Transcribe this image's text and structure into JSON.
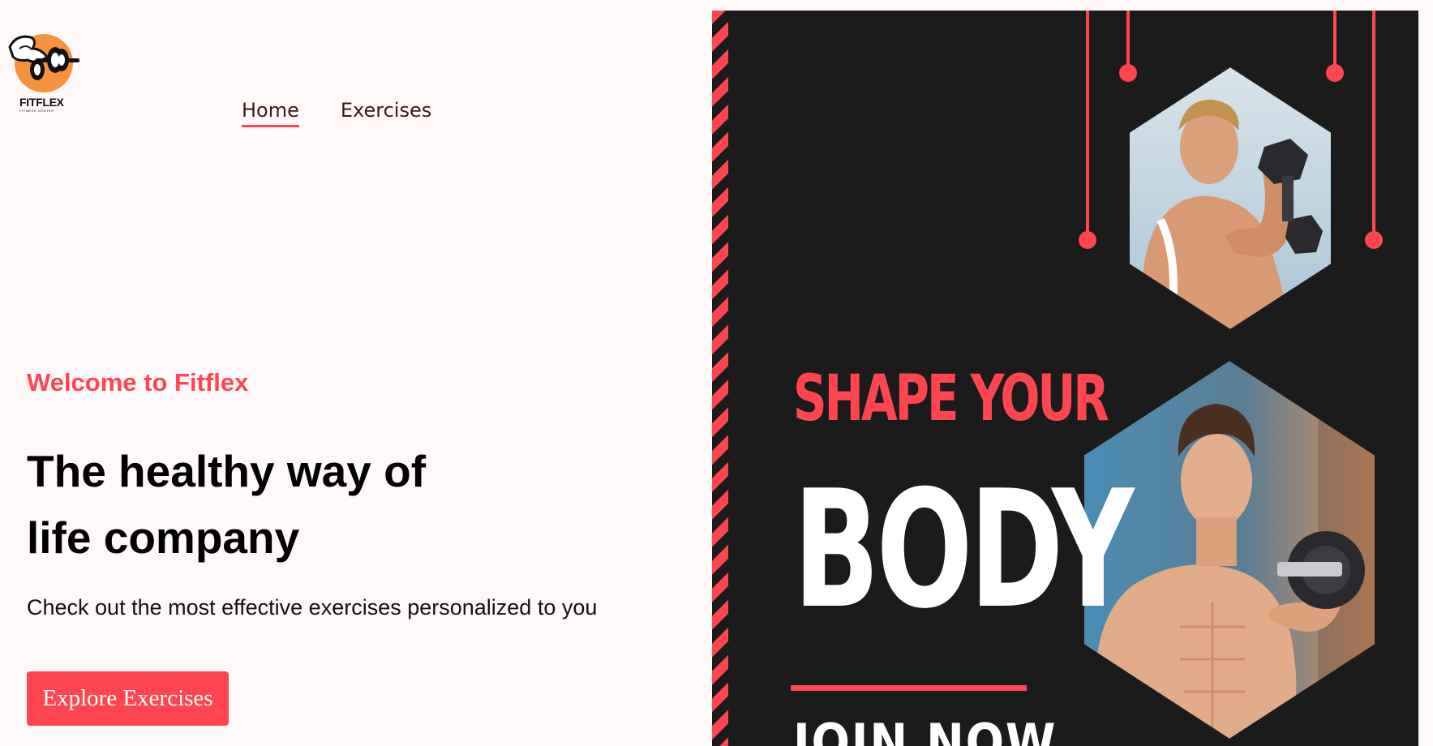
{
  "brand": {
    "name": "FITFLEX",
    "tagline": "FITNESS CENTER",
    "logo_icon": "barbell-bodybuilder-icon"
  },
  "nav": {
    "items": [
      {
        "label": "Home",
        "active": true
      },
      {
        "label": "Exercises",
        "active": false
      }
    ]
  },
  "hero": {
    "eyebrow": "Welcome to Fitflex",
    "headline": "The healthy way of life company",
    "subtitle": "Check out the most effective exercises personalized to you",
    "cta_label": "Explore Exercises"
  },
  "banner": {
    "line1": "SHAPE YOUR",
    "line2": "BODY",
    "line3": "JOIN NOW",
    "images": [
      "man-curling-dumbbell-photo",
      "shirtless-man-curling-dumbbell-photo"
    ]
  },
  "colors": {
    "accent": "#ff4650",
    "page_bg": "#fff8f9",
    "banner_bg": "#1c1b1c",
    "logo_orange": "#f6923e"
  }
}
